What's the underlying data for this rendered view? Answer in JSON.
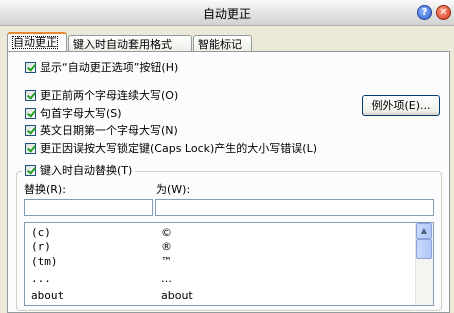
{
  "window": {
    "title": "自动更正"
  },
  "tabs": [
    {
      "label": "自动更正"
    },
    {
      "label": "键入时自动套用格式"
    },
    {
      "label": "智能标记"
    }
  ],
  "options": {
    "show_buttons": "显示“自动更正选项”按钮(H)",
    "two_initial_caps": "更正前两个字母连续大写(O)",
    "capitalize_sentences": "句首字母大写(S)",
    "capitalize_days": "英文日期第一个字母大写(N)",
    "caps_lock": "更正因误按大写锁定键(Caps Lock)产生的大小写错误(L)",
    "replace_as_you_type": "键入时自动替换(T)"
  },
  "exceptions_button": "例外项(E)...",
  "replace": {
    "replace_label": "替换(R):",
    "with_label": "为(W):",
    "replace_value": "",
    "with_value": ""
  },
  "entries": [
    {
      "replace": "(c)",
      "with": "©"
    },
    {
      "replace": "(r)",
      "with": "®"
    },
    {
      "replace": "(tm)",
      "with": "™"
    },
    {
      "replace": "...",
      "with": "…"
    },
    {
      "replace": "about",
      "with": "about"
    }
  ],
  "colors": {
    "dialog_bg": "#ECE9D8",
    "panel_bg": "#FCFCFE",
    "tab_accent": "#E68B2C",
    "check": "#21A121"
  }
}
